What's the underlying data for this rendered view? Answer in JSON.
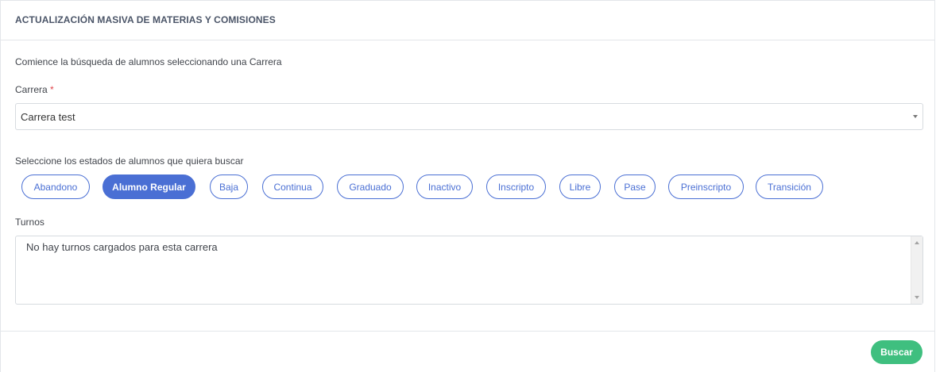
{
  "header": {
    "title": "ACTUALIZACIÓN MASIVA DE MATERIAS Y COMISIONES"
  },
  "intro_text": "Comience la búsqueda de alumnos seleccionando una Carrera",
  "carrera": {
    "label": "Carrera",
    "required_mark": "*",
    "selected_value": "Carrera test"
  },
  "estados": {
    "label": "Seleccione los estados de alumnos que quiera buscar",
    "options": [
      {
        "label": "Abandono",
        "active": false
      },
      {
        "label": "Alumno Regular",
        "active": true
      },
      {
        "label": "Baja",
        "active": false
      },
      {
        "label": "Continua",
        "active": false
      },
      {
        "label": "Graduado",
        "active": false
      },
      {
        "label": "Inactivo",
        "active": false
      },
      {
        "label": "Inscripto",
        "active": false
      },
      {
        "label": "Libre",
        "active": false
      },
      {
        "label": "Pase",
        "active": false
      },
      {
        "label": "Preinscripto",
        "active": false
      },
      {
        "label": "Transición",
        "active": false
      }
    ]
  },
  "turnos": {
    "label": "Turnos",
    "value": "No hay turnos cargados para esta carrera"
  },
  "footer": {
    "search_label": "Buscar"
  },
  "colors": {
    "primary": "#4a6fd4",
    "success": "#3fbf7f",
    "required": "#e0454b"
  }
}
